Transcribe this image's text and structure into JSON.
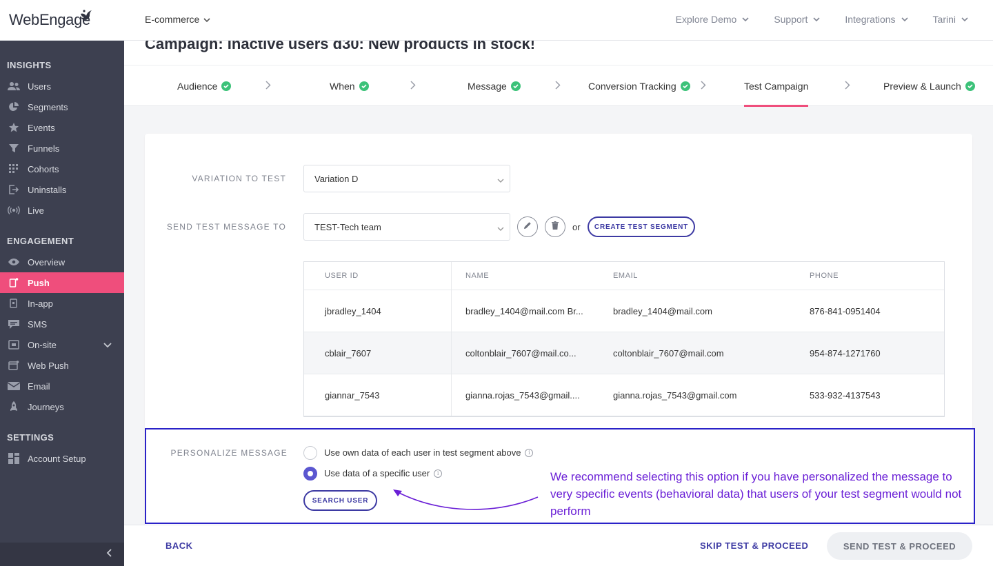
{
  "brand": {
    "logo_text": "WebEngage",
    "accent": "#ef4e7c",
    "primary": "#3d3aa3"
  },
  "topbar": {
    "project": "E-commerce",
    "nav": [
      "Explore Demo",
      "Support",
      "Integrations",
      "Tarini"
    ]
  },
  "sidebar": {
    "insights_title": "INSIGHTS",
    "insights": [
      {
        "label": "Users",
        "icon": "users-icon"
      },
      {
        "label": "Segments",
        "icon": "pie-icon"
      },
      {
        "label": "Events",
        "icon": "star-icon"
      },
      {
        "label": "Funnels",
        "icon": "funnel-icon"
      },
      {
        "label": "Cohorts",
        "icon": "grid-icon"
      },
      {
        "label": "Uninstalls",
        "icon": "exit-icon"
      },
      {
        "label": "Live",
        "icon": "broadcast-icon"
      }
    ],
    "engagement_title": "ENGAGEMENT",
    "engagement": [
      {
        "label": "Overview",
        "icon": "eye-icon"
      },
      {
        "label": "Push",
        "icon": "push-icon"
      },
      {
        "label": "In-app",
        "icon": "inapp-icon"
      },
      {
        "label": "SMS",
        "icon": "sms-icon"
      },
      {
        "label": "On-site",
        "icon": "onsite-icon"
      },
      {
        "label": "Web Push",
        "icon": "webpush-icon"
      },
      {
        "label": "Email",
        "icon": "email-icon"
      },
      {
        "label": "Journeys",
        "icon": "rocket-icon"
      }
    ],
    "settings_title": "SETTINGS",
    "settings": [
      {
        "label": "Account Setup",
        "icon": "apps-icon"
      }
    ]
  },
  "campaign": {
    "title": "Campaign: Inactive users d30: New products in stock!"
  },
  "tabs": [
    {
      "label": "Audience",
      "done": true
    },
    {
      "label": "When",
      "done": true
    },
    {
      "label": "Message",
      "done": true
    },
    {
      "label": "Conversion Tracking",
      "done": true
    },
    {
      "label": "Test Campaign",
      "done": false
    },
    {
      "label": "Preview & Launch",
      "done": true
    }
  ],
  "form": {
    "variation_label": "VARIATION TO TEST",
    "variation_value": "Variation D",
    "send_label": "SEND TEST MESSAGE TO",
    "send_value": "TEST-Tech team",
    "or_text": "or",
    "create_segment": "CREATE TEST SEGMENT"
  },
  "table": {
    "headers": [
      "USER ID",
      "NAME",
      "EMAIL",
      "PHONE"
    ],
    "rows": [
      [
        "jbradley_1404",
        "bradley_1404@mail.com Br...",
        "bradley_1404@mail.com",
        "876-841-0951404"
      ],
      [
        "cblair_7607",
        "coltonblair_7607@mail.co...",
        "coltonblair_7607@mail.com",
        "954-874-1271760"
      ],
      [
        "giannar_7543",
        "gianna.rojas_7543@gmail....",
        "gianna.rojas_7543@gmail.com",
        "533-932-4137543"
      ]
    ]
  },
  "personalize": {
    "label": "PERSONALIZE MESSAGE",
    "option1": "Use own data of each user in test segment above",
    "option2": "Use data of a specific user",
    "selected": 2,
    "search_user": "SEARCH USER",
    "note": "We recommend selecting this option if you have personalized the message to very specific events (behavioral data) that users of your test segment would not perform"
  },
  "footer": {
    "back": "BACK",
    "skip": "SKIP TEST & PROCEED",
    "send": "SEND TEST & PROCEED"
  }
}
